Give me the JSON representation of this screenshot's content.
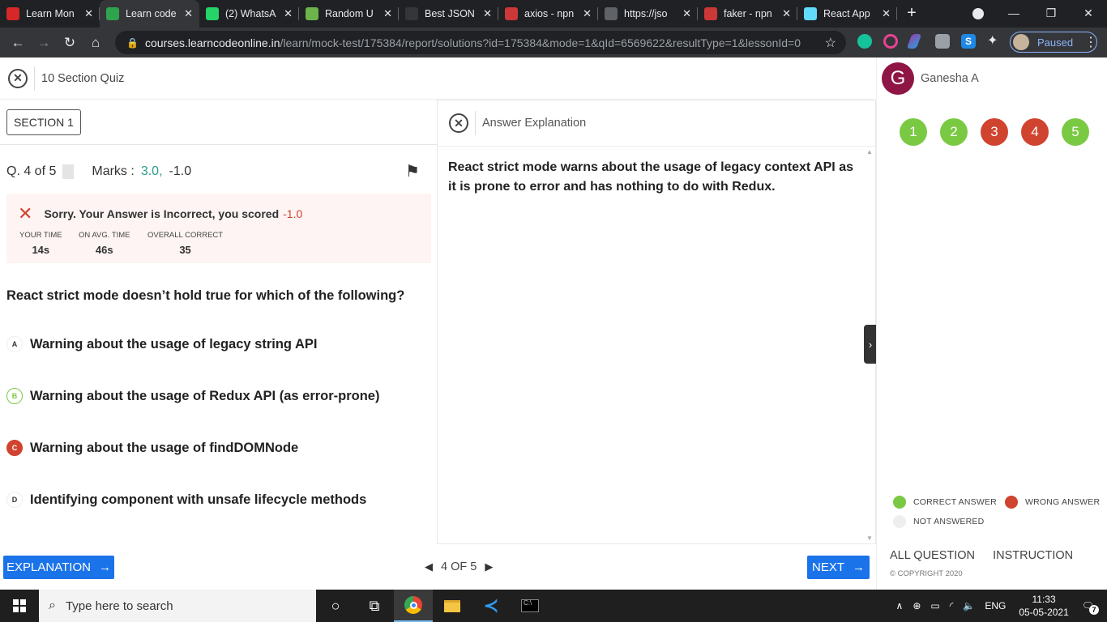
{
  "browser": {
    "tabs": [
      {
        "title": "Learn Mon",
        "icon": "v-logo-icon",
        "color": "#d62828"
      },
      {
        "title": "Learn code",
        "icon": "code-brackets-icon",
        "color": "#2ea44f",
        "active": true
      },
      {
        "title": "(2) WhatsA",
        "icon": "whatsapp-icon",
        "color": "#25d366"
      },
      {
        "title": "Random U",
        "icon": "smiley-icon",
        "color": "#6bb34a"
      },
      {
        "title": "Best JSON",
        "icon": "blank-page-icon",
        "color": "#35363a"
      },
      {
        "title": "axios - npn",
        "icon": "npm-icon",
        "color": "#cb3837"
      },
      {
        "title": "https://jso",
        "icon": "globe-icon",
        "color": "#5f6368"
      },
      {
        "title": "faker - npn",
        "icon": "npm-icon",
        "color": "#cb3837"
      },
      {
        "title": "React App",
        "icon": "react-icon",
        "color": "#61dafb"
      }
    ],
    "url_host": "courses.learncodeonline.in",
    "url_path": "/learn/mock-test/175384/report/solutions?id=175384&mode=1&qId=6569622&resultType=1&lessonId=0",
    "profile_status": "Paused"
  },
  "header": {
    "quiz_title": "10 Section Quiz",
    "user_initial": "G",
    "user_name": "Ganesha A"
  },
  "section_label": "SECTION 1",
  "question_meta": {
    "position": "Q. 4 of 5",
    "marks_label": "Marks :",
    "marks_positive": "3.0,",
    "marks_negative": "-1.0"
  },
  "result": {
    "message": "Sorry. Your Answer is Incorrect, you scored",
    "score": "-1.0",
    "stats": [
      {
        "label": "YOUR TIME",
        "value": "14s"
      },
      {
        "label": "ON AVG. TIME",
        "value": "46s"
      },
      {
        "label": "OVERALL CORRECT",
        "value": "35"
      }
    ]
  },
  "question_text": "React strict mode doesn’t hold true for which of the following?",
  "options": [
    {
      "letter": "A",
      "text": "Warning about the usage of legacy string API",
      "state": "none"
    },
    {
      "letter": "B",
      "text": "Warning about the usage of Redux API (as error-prone)",
      "state": "correct"
    },
    {
      "letter": "C",
      "text": "Warning about the usage of findDOMNode",
      "state": "wrong"
    },
    {
      "letter": "D",
      "text": "Identifying component with unsafe lifecycle methods",
      "state": "none"
    }
  ],
  "explanation": {
    "title": "Answer Explanation",
    "body": "React strict mode warns about the usage of legacy context API as it is prone to error and has nothing to do with Redux."
  },
  "question_nav": [
    {
      "num": "1",
      "status": "correct"
    },
    {
      "num": "2",
      "status": "correct"
    },
    {
      "num": "3",
      "status": "wrong"
    },
    {
      "num": "4",
      "status": "wrong"
    },
    {
      "num": "5",
      "status": "correct"
    }
  ],
  "legend": {
    "correct": "CORRECT ANSWER",
    "wrong": "WRONG ANSWER",
    "not_answered": "NOT ANSWERED"
  },
  "colors": {
    "correct": "#7ac943",
    "wrong": "#d0432f",
    "not_answered": "#eeeeee",
    "primary": "#1a73e8",
    "marks_positive": "#2a9d8f"
  },
  "footer": {
    "explanation_button": "EXPLANATION",
    "pager": "4 OF 5",
    "next_button": "NEXT",
    "all_question": "ALL QUESTION",
    "instruction": "INSTRUCTION",
    "copyright": "© COPYRIGHT 2020"
  },
  "taskbar": {
    "search_placeholder": "Type here to search",
    "language": "ENG",
    "time": "11:33",
    "date": "05-05-2021",
    "notifications": "7"
  }
}
